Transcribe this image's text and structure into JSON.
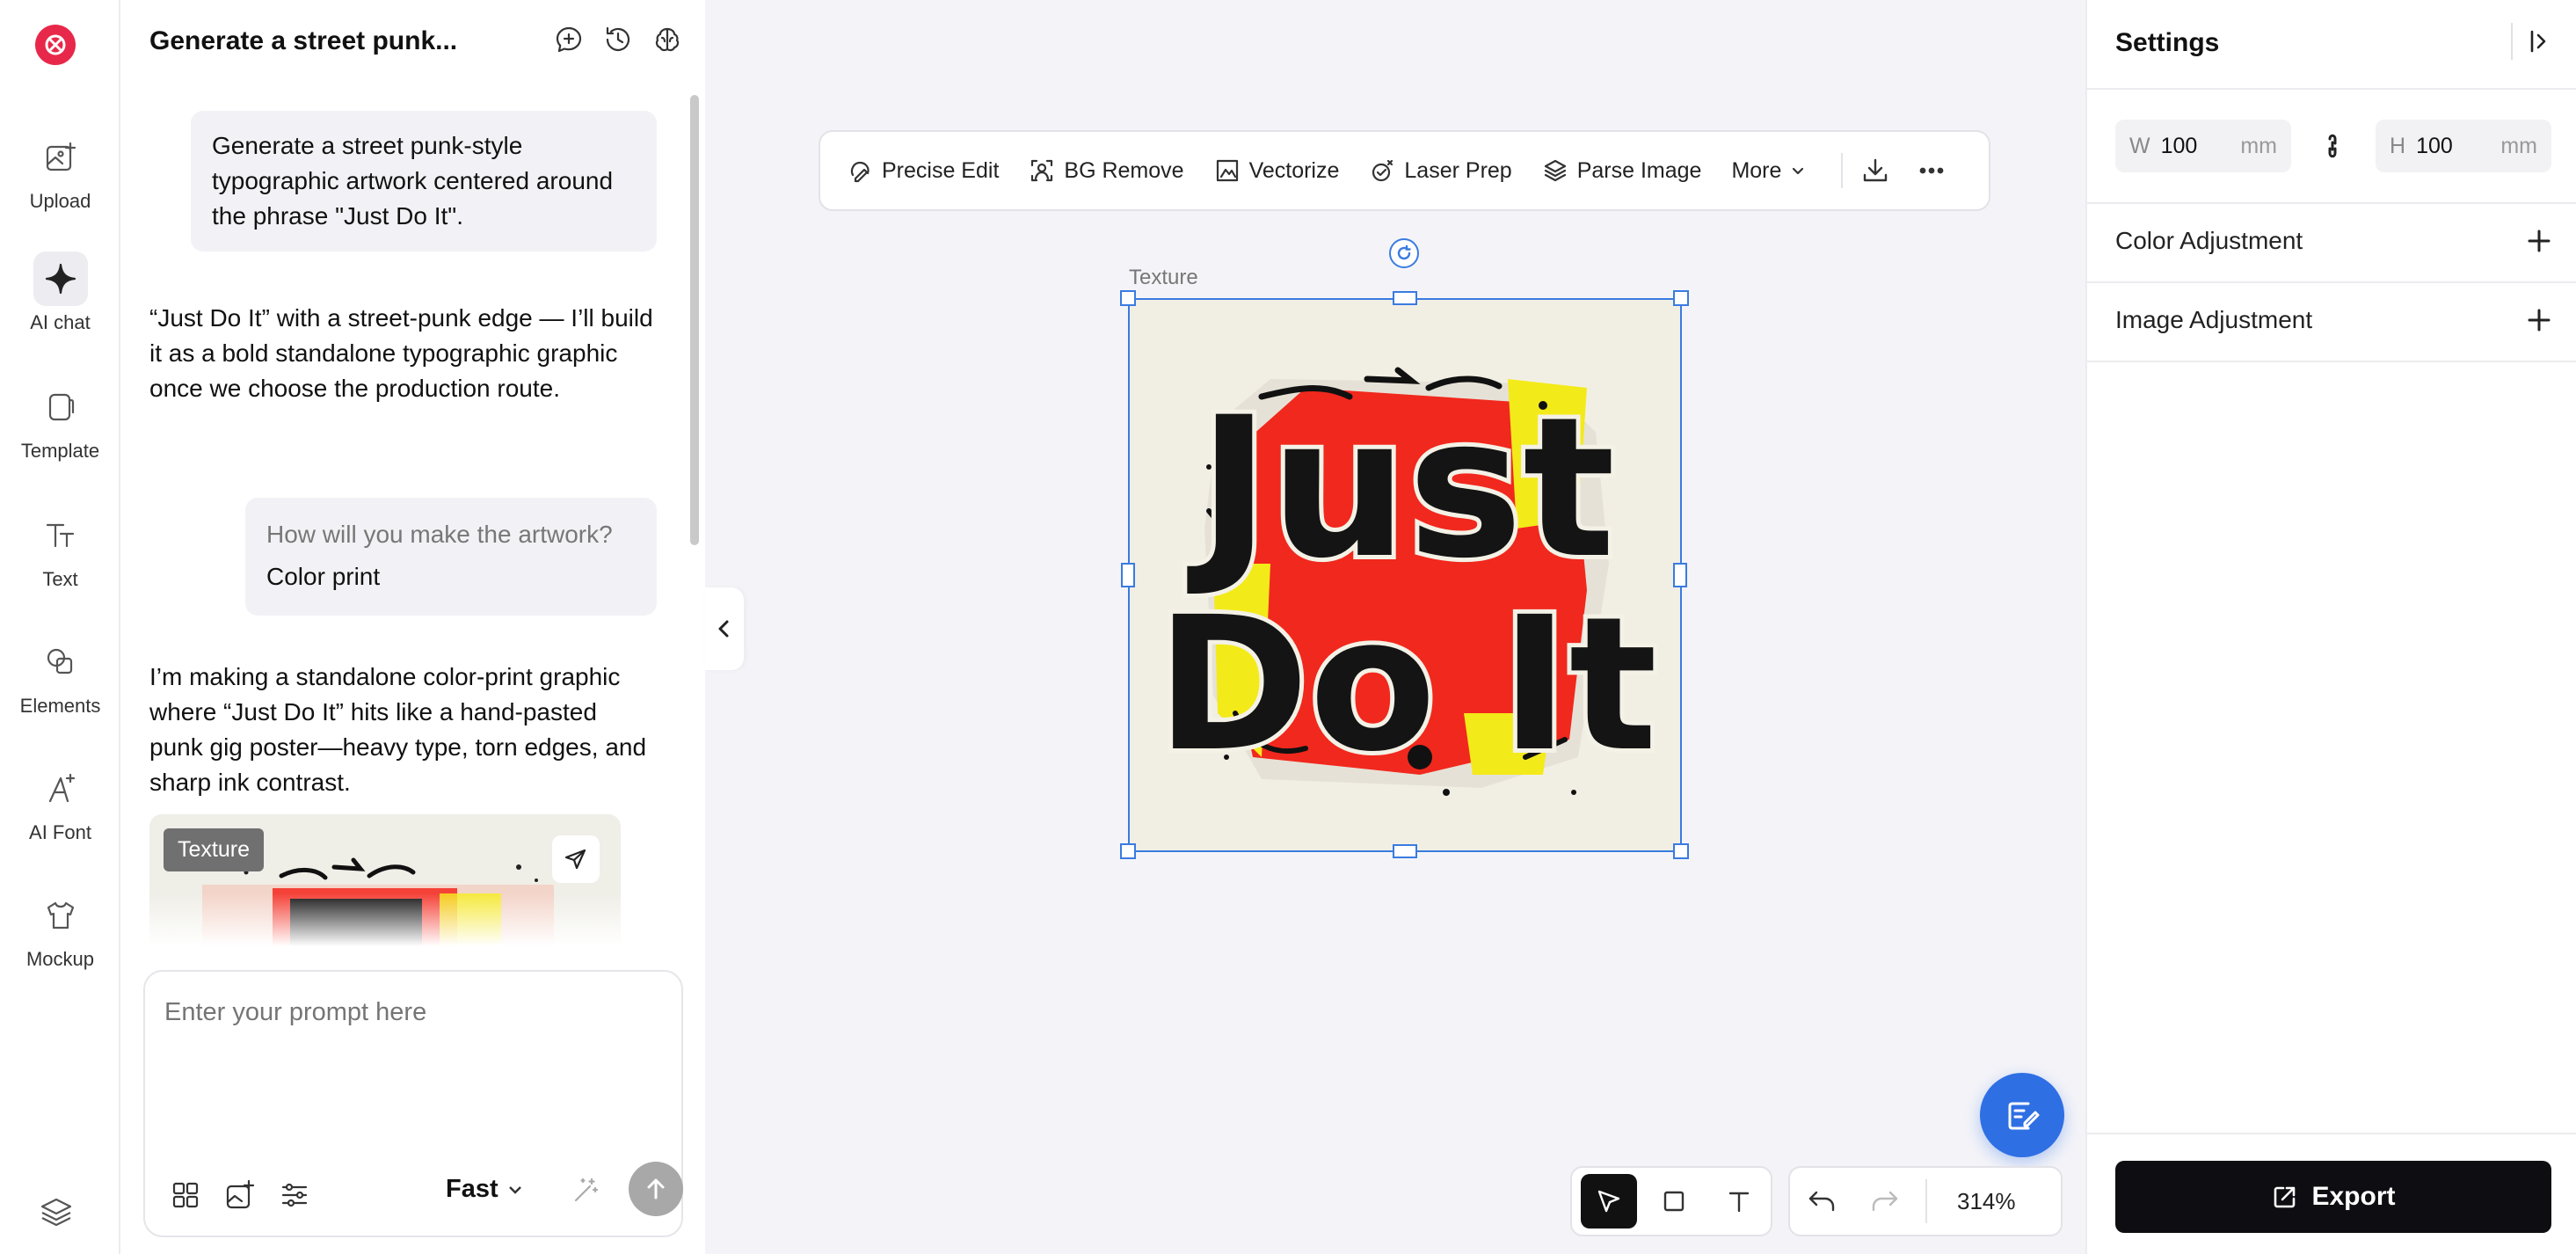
{
  "rail": {
    "items": [
      {
        "label": "Upload",
        "icon": "upload-image-icon"
      },
      {
        "label": "AI chat",
        "icon": "sparkle-icon",
        "active": true
      },
      {
        "label": "Template",
        "icon": "template-icon"
      },
      {
        "label": "Text",
        "icon": "text-icon"
      },
      {
        "label": "Elements",
        "icon": "elements-icon"
      },
      {
        "label": "AI Font",
        "icon": "ai-font-icon"
      },
      {
        "label": "Mockup",
        "icon": "tshirt-icon"
      }
    ]
  },
  "chat": {
    "title": "Generate a street punk...",
    "messages": {
      "user1": "Generate a street punk-style typographic artwork centered around the phrase \"Just Do It\".",
      "ai1": "“Just Do It” with a street-punk edge — I’ll build it as a bold standalone typographic graphic once we choose the production route.",
      "question": "How will you make the artwork?",
      "answer": "Color print",
      "ai2": "I’m making a standalone color-print graphic where “Just Do It” hits like a hand-pasted punk gig poster—heavy type, torn edges, and sharp ink contrast."
    },
    "thumb_tag": "Texture",
    "prompt_placeholder": "Enter your prompt here",
    "speed": "Fast"
  },
  "toolbar": {
    "items": [
      "Precise Edit",
      "BG Remove",
      "Vectorize",
      "Laser Prep",
      "Parse Image",
      "More"
    ]
  },
  "canvas": {
    "layer_label": "Texture",
    "artwork_text": [
      "Just",
      "Do It"
    ],
    "zoom": "314%"
  },
  "settings": {
    "title": "Settings",
    "width": {
      "label": "W",
      "value": "100",
      "unit": "mm"
    },
    "height": {
      "label": "H",
      "value": "100",
      "unit": "mm"
    },
    "sections": [
      "Color Adjustment",
      "Image Adjustment"
    ],
    "export_label": "Export"
  },
  "colors": {
    "brand": "#e8284a",
    "selection": "#3a7be0",
    "fab": "#2f6fe4",
    "export_bg": "#0e0e12"
  }
}
